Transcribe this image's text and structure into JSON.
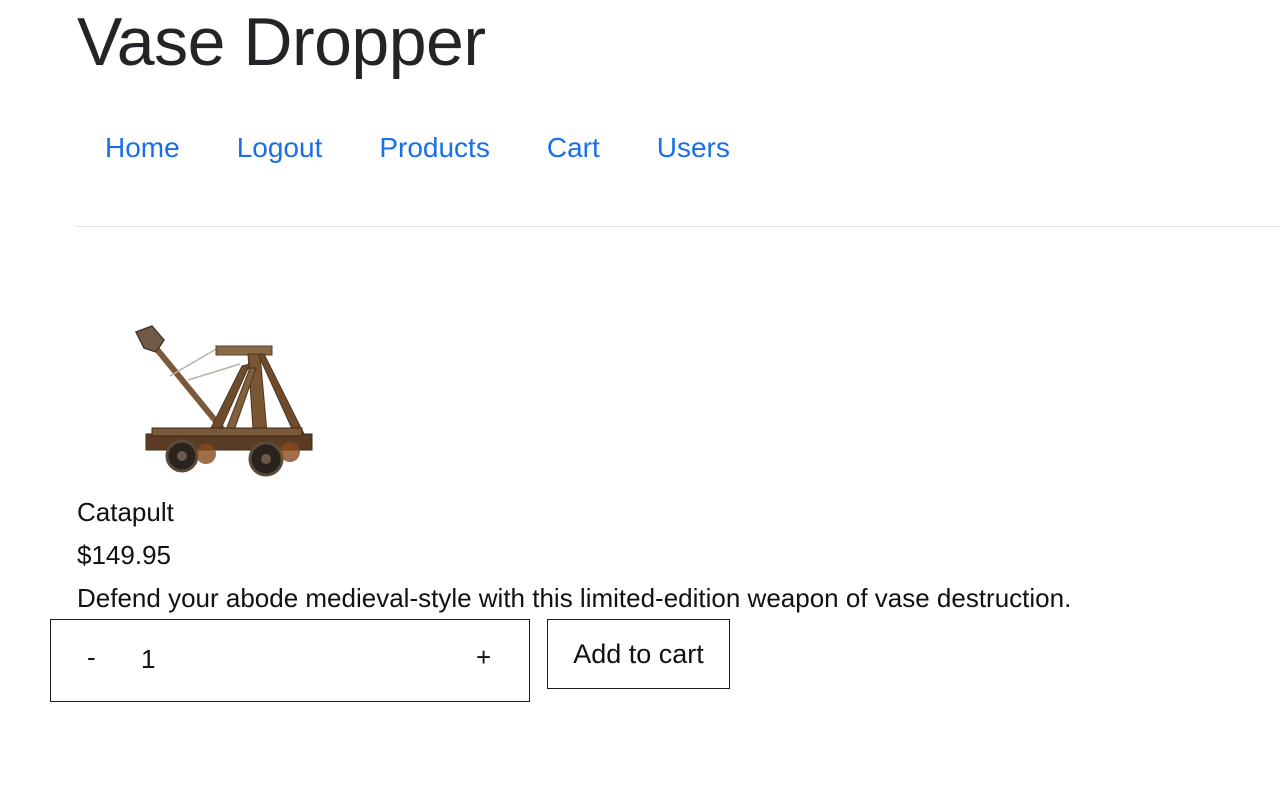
{
  "site": {
    "title": "Vase Dropper"
  },
  "nav": {
    "items": [
      {
        "label": "Home"
      },
      {
        "label": "Logout"
      },
      {
        "label": "Products"
      },
      {
        "label": "Cart"
      },
      {
        "label": "Users"
      }
    ]
  },
  "product": {
    "image_icon": "catapult-image",
    "name": "Catapult",
    "price": "$149.95",
    "description": "Defend your abode medieval-style with this limited-edition weapon of vase destruction."
  },
  "quantity": {
    "minus_label": "-",
    "value": "1",
    "plus_label": "+"
  },
  "actions": {
    "add_to_cart_label": "Add to cart"
  },
  "colors": {
    "link": "#1a6fe8",
    "text": "#111111",
    "divider": "#e1e3e6"
  }
}
